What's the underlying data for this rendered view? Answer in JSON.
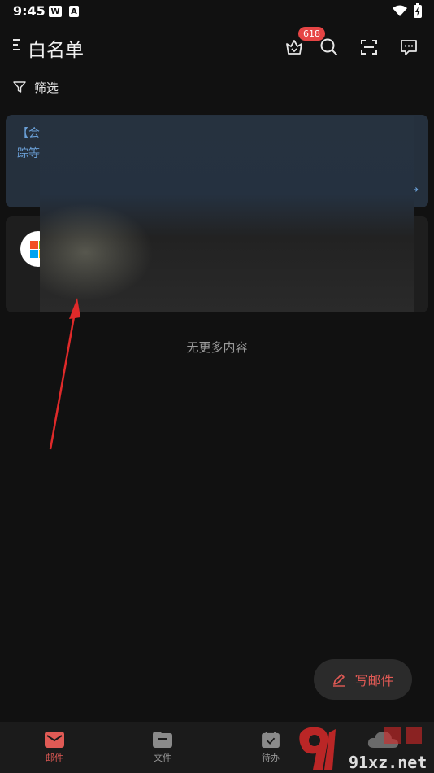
{
  "status_bar": {
    "time": "9:45",
    "app_icons": [
      "W",
      "A"
    ]
  },
  "header": {
    "title": "白名单",
    "badge": "618",
    "icons": [
      "menu-icon",
      "crown-icon",
      "search-icon",
      "scan-icon",
      "message-icon"
    ]
  },
  "filter": {
    "label": "筛选",
    "icon": "filter-icon"
  },
  "cards": {
    "promo_line1": "【会",
    "promo_line2": "踪等",
    "promo_link": "→"
  },
  "empty_hint": "无更多内容",
  "compose": {
    "label": "写邮件",
    "icon": "pen-icon"
  },
  "bottom_nav": {
    "items": [
      {
        "label": "邮件",
        "icon": "mail-icon",
        "active": true
      },
      {
        "label": "文件",
        "icon": "folder-icon",
        "active": false
      },
      {
        "label": "待办",
        "icon": "calendar-check-icon",
        "active": false
      }
    ]
  },
  "watermark": {
    "text": "91xz.net"
  },
  "colors": {
    "background": "#111111",
    "accent": "#e05a55",
    "badge": "#e64545",
    "link": "#6a9fd6"
  }
}
